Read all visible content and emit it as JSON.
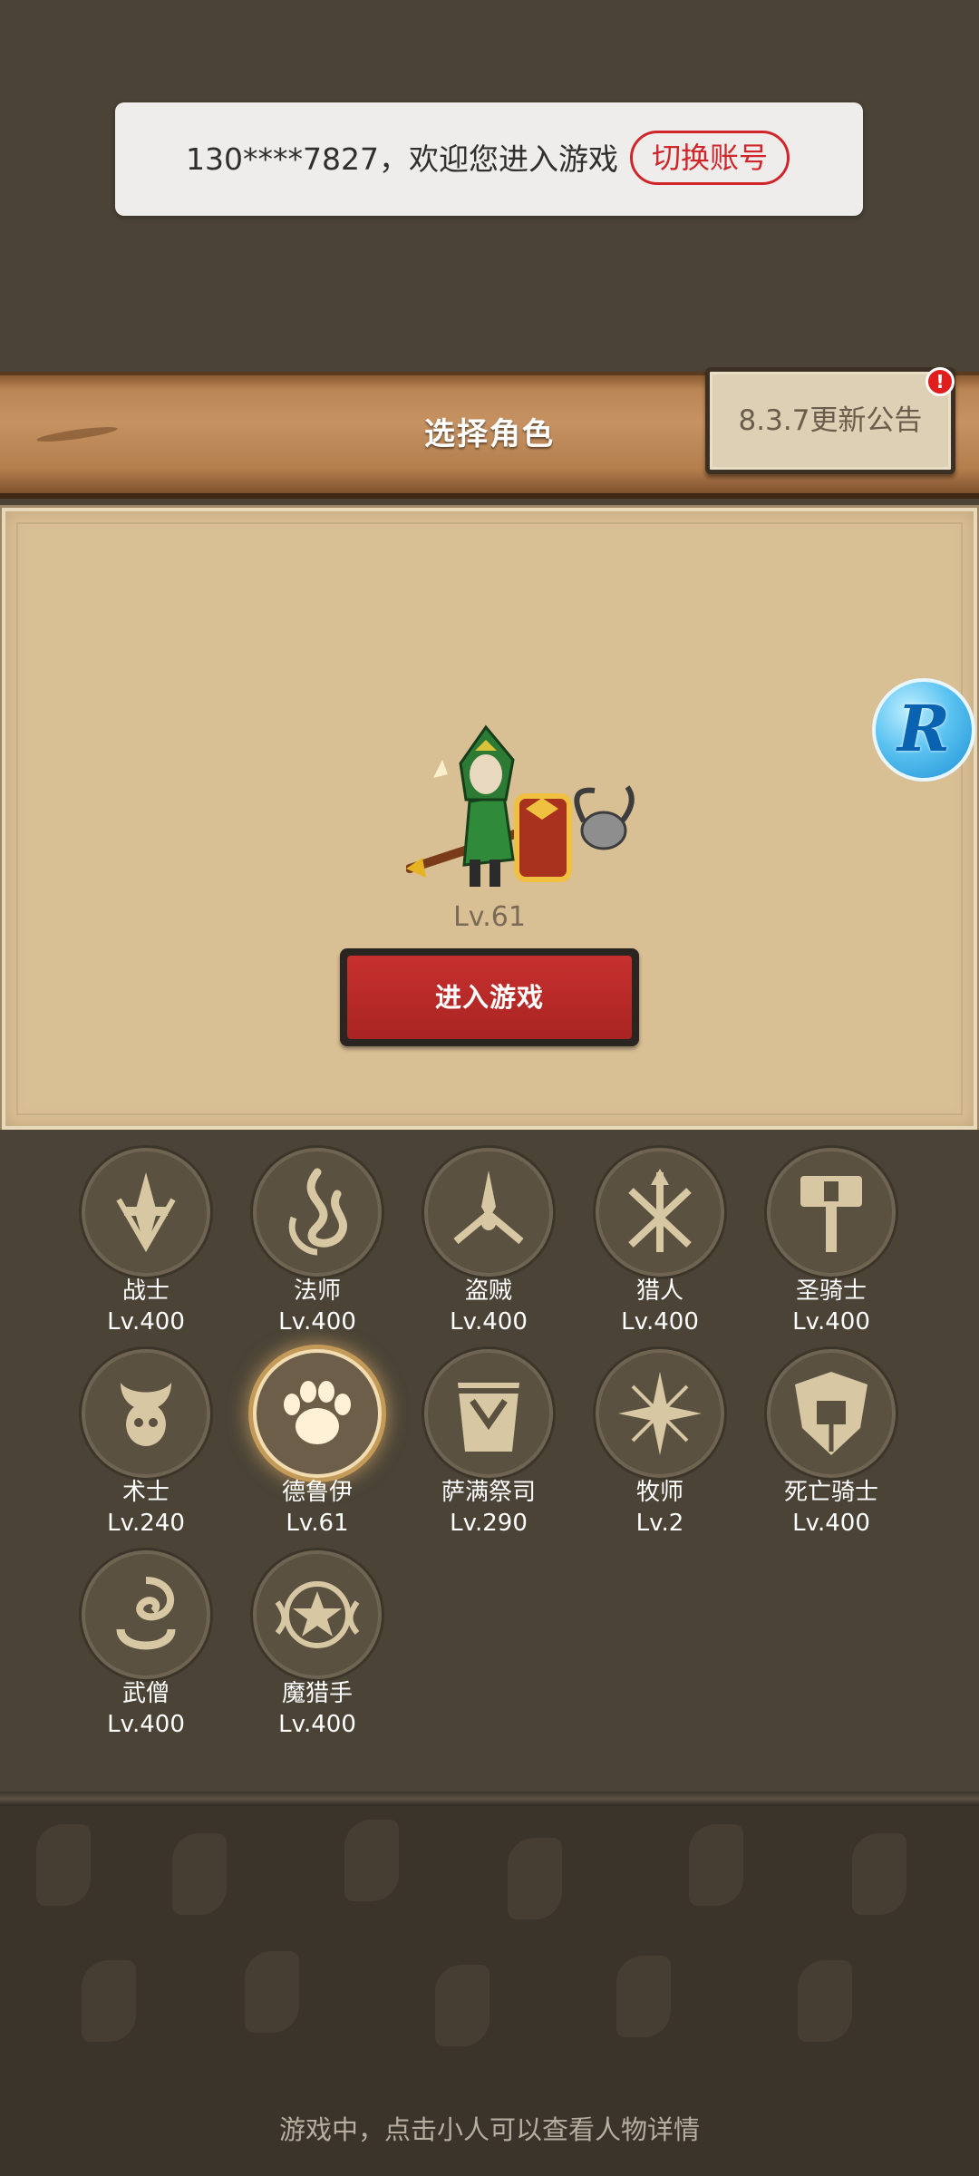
{
  "toast": {
    "message": "130****7827，欢迎您进入游戏",
    "switch_label": "切换账号"
  },
  "header": {
    "title": "选择角色",
    "notice_label": "8.3.7更新公告",
    "notice_badge": "!"
  },
  "character": {
    "level": "Lv.61",
    "enter_label": "进入游戏"
  },
  "float_button": {
    "label": "R"
  },
  "classes": [
    {
      "name": "战士",
      "level": "Lv.400",
      "icon": "warrior-sword-icon"
    },
    {
      "name": "法师",
      "level": "Lv.400",
      "icon": "mage-flame-icon"
    },
    {
      "name": "盗贼",
      "level": "Lv.400",
      "icon": "rogue-daggers-icon"
    },
    {
      "name": "猎人",
      "level": "Lv.400",
      "icon": "hunter-arrows-icon"
    },
    {
      "name": "圣骑士",
      "level": "Lv.400",
      "icon": "paladin-hammer-icon"
    },
    {
      "name": "术士",
      "level": "Lv.240",
      "icon": "warlock-skull-icon"
    },
    {
      "name": "德鲁伊",
      "level": "Lv.61",
      "icon": "druid-paw-icon",
      "selected": true
    },
    {
      "name": "萨满祭司",
      "level": "Lv.290",
      "icon": "shaman-totem-icon"
    },
    {
      "name": "牧师",
      "level": "Lv.2",
      "icon": "priest-star-icon"
    },
    {
      "name": "死亡骑士",
      "level": "Lv.400",
      "icon": "death-knight-helm-icon"
    },
    {
      "name": "武僧",
      "level": "Lv.400",
      "icon": "monk-swirl-icon"
    },
    {
      "name": "魔猎手",
      "level": "Lv.400",
      "icon": "demon-hunter-star-icon"
    }
  ],
  "footer": {
    "hint": "游戏中，点击小人可以查看人物详情"
  }
}
